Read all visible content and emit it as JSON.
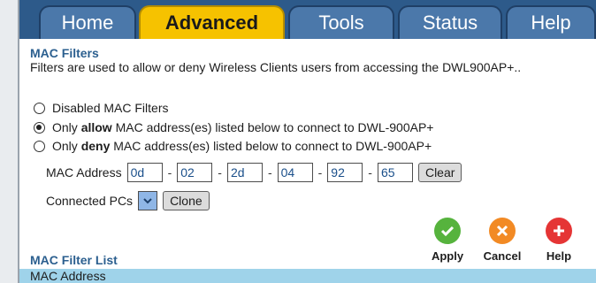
{
  "tabs": [
    {
      "label": "Home"
    },
    {
      "label": "Advanced"
    },
    {
      "label": "Tools"
    },
    {
      "label": "Status"
    },
    {
      "label": "Help"
    }
  ],
  "section": {
    "title": "MAC Filters",
    "description": "Filters are used to allow or deny Wireless Clients users from accessing the DWL900AP+.."
  },
  "options": {
    "disabled": "Disabled MAC Filters",
    "allow_prefix": "Only",
    "allow_bold": "allow",
    "allow_suffix": "MAC address(es) listed below to connect to DWL-900AP+",
    "deny_prefix": "Only",
    "deny_bold": "deny",
    "deny_suffix": "MAC address(es) listed below to connect to DWL-900AP+",
    "selected": "allow"
  },
  "mac": {
    "label": "MAC Address",
    "octets": [
      "0d",
      "02",
      "2d",
      "04",
      "92",
      "65"
    ],
    "clear_label": "Clear"
  },
  "connected": {
    "label": "Connected PCs",
    "clone_label": "Clone"
  },
  "actions": {
    "apply": "Apply",
    "cancel": "Cancel",
    "help": "Help"
  },
  "list": {
    "title": "MAC Filter List",
    "column_header": "MAC Address"
  },
  "colors": {
    "tab_active": "#f6c200",
    "tab_bar": "#2d5a8a",
    "apply_green": "#56b33d",
    "cancel_orange": "#f28a24",
    "help_red": "#e53535",
    "list_header": "#9fd3ea"
  },
  "icons": {
    "apply": "checkmark-icon",
    "cancel": "x-icon",
    "help": "plus-icon",
    "dropdown": "chevron-down-icon"
  }
}
